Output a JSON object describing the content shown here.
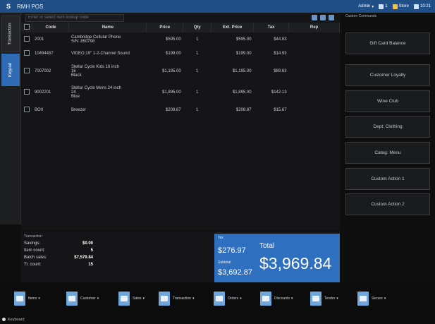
{
  "app": {
    "logo_text": "S",
    "title": "RMH POS",
    "status": {
      "user": "Admin",
      "register": "1",
      "store": "Store",
      "time": "10:21"
    }
  },
  "sidetabs": {
    "transaction": "Transaction",
    "keypad": "Keypad"
  },
  "search": {
    "placeholder": "Enter or select item lookup code"
  },
  "grid": {
    "headers": [
      "",
      "Code",
      "Name",
      "Price",
      "Qty",
      "Ext. Price",
      "Tax",
      "Rep"
    ],
    "rows": [
      {
        "code": "2001",
        "name": "Cambridge Cellular Phone",
        "name2": "S/N: 850798",
        "name3": "",
        "price": "$595.00",
        "qty": "1",
        "ext": "$595.00",
        "tax": "$44.63",
        "rep": ""
      },
      {
        "code": "10494457",
        "name": "VIDEO 19\" 1-2-Channel Sound",
        "name2": "",
        "name3": "",
        "price": "$199.00",
        "qty": "1",
        "ext": "$199.00",
        "tax": "$14.93",
        "rep": ""
      },
      {
        "code": "7007002",
        "name": "Stellar Cycle Kids 16 inch",
        "name2": "16",
        "name3": "Black",
        "price": "$1,195.00",
        "qty": "1",
        "ext": "$1,195.00",
        "tax": "$89.63",
        "rep": ""
      },
      {
        "code": "9002201",
        "name": "Stellar Cycle Mens 24 inch",
        "name2": "24",
        "name3": "Blue",
        "price": "$1,895.00",
        "qty": "1",
        "ext": "$1,895.00",
        "tax": "$142.13",
        "rep": ""
      },
      {
        "code": "BOX",
        "name": "Breezer",
        "name2": "",
        "name3": "",
        "price": "$208.87",
        "qty": "1",
        "ext": "$208.87",
        "tax": "$15.67",
        "rep": ""
      }
    ]
  },
  "rightpanel": {
    "label": "Custom Commands",
    "buttons": [
      "Gift Card Balance",
      "Customer Loyalty",
      "Wine Club",
      "Dept: Clothing",
      "Categ: Menu",
      "Custom Action 1",
      "Custom Action 2"
    ]
  },
  "summary": {
    "header": "Transaction",
    "lines": [
      {
        "label": "Savings:",
        "value": "$0.00"
      },
      {
        "label": "Item count:",
        "value": "5"
      },
      {
        "label": "Batch sales:",
        "value": "$7,579.84"
      },
      {
        "label": "Tr. count:",
        "value": "15"
      }
    ]
  },
  "totals": {
    "tax_label": "Tax",
    "tax": "$276.97",
    "subtotal_label": "Subtotal",
    "subtotal": "$3,692.87",
    "total_label": "Total",
    "total": "$3,969.84"
  },
  "toolbar": [
    "Items",
    "Customer",
    "Sales",
    "Transaction",
    "Orders",
    "Discounts",
    "Tender",
    "Secure"
  ],
  "statusbar": {
    "keyboard": "Keyboard"
  },
  "colors": {
    "accent": "#2e6fc0",
    "title_bar": "#1f4f86",
    "icon": "#6fa6de"
  }
}
